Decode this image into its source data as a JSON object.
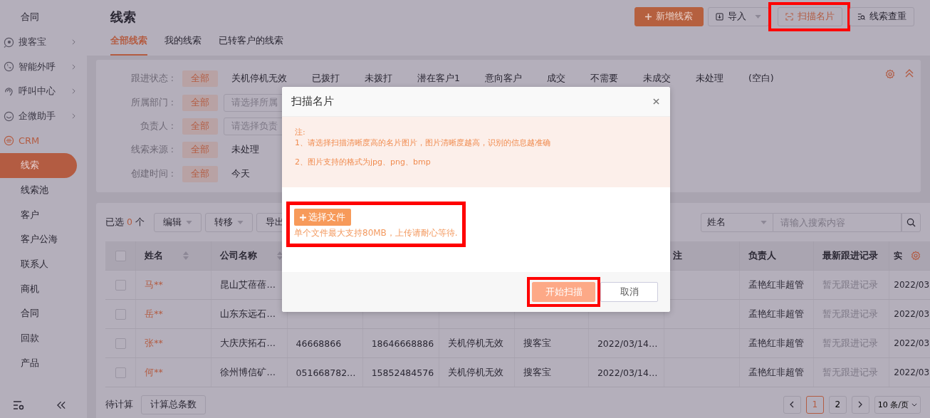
{
  "sidebar": {
    "items": [
      {
        "kind": "sub",
        "label": "合同",
        "selected": false
      },
      {
        "kind": "group",
        "label": "搜客宝",
        "expanded": false
      },
      {
        "kind": "group",
        "label": "智能外呼",
        "expanded": false
      },
      {
        "kind": "group",
        "label": "呼叫中心",
        "expanded": false
      },
      {
        "kind": "group",
        "label": "企微助手",
        "expanded": false
      },
      {
        "kind": "group",
        "label": "CRM",
        "expanded": true,
        "children": [
          {
            "label": "线索",
            "selected": true
          },
          {
            "label": "线索池",
            "selected": false
          },
          {
            "label": "客户",
            "selected": false
          },
          {
            "label": "客户公海",
            "selected": false
          },
          {
            "label": "联系人",
            "selected": false
          },
          {
            "label": "商机",
            "selected": false
          },
          {
            "label": "合同",
            "selected": false
          },
          {
            "label": "回款",
            "selected": false
          },
          {
            "label": "产品",
            "selected": false
          }
        ]
      }
    ]
  },
  "header": {
    "title": "线索",
    "tabs": [
      {
        "label": "全部线索",
        "selected": true
      },
      {
        "label": "我的线索",
        "selected": false
      },
      {
        "label": "已转客户的线索",
        "selected": false
      }
    ],
    "actions": [
      {
        "label": "新增线索",
        "kind": "primary",
        "dropdown": false,
        "highlighted": false
      },
      {
        "label": "导入",
        "kind": "default",
        "dropdown": true,
        "highlighted": false
      },
      {
        "label": "扫描名片",
        "kind": "accent",
        "dropdown": false,
        "highlighted": true
      },
      {
        "label": "线索查重",
        "kind": "default",
        "dropdown": false,
        "highlighted": false
      }
    ]
  },
  "filters": [
    {
      "label": "跟进状态 :",
      "all": {
        "label": "全部",
        "selected": true
      },
      "kind": "options",
      "options": [
        "关机停机无效",
        "已拨打",
        "未拨打",
        "潜在客户1",
        "意向客户",
        "成交",
        "不需要",
        "未成交",
        "未处理",
        "(空白)"
      ]
    },
    {
      "label": "所属部门 :",
      "all": {
        "label": "全部",
        "selected": true
      },
      "kind": "select",
      "placeholder": "请选择所属"
    },
    {
      "label": "负责人 :",
      "all": {
        "label": "全部",
        "selected": true
      },
      "kind": "select",
      "placeholder": "请选择负责"
    },
    {
      "label": "线索来源 :",
      "all": {
        "label": "全部",
        "selected": true
      },
      "kind": "options",
      "options": [
        "未处理"
      ]
    },
    {
      "label": "创建时间 :",
      "all": {
        "label": "全部",
        "selected": true
      },
      "kind": "options",
      "options": [
        "今天"
      ]
    }
  ],
  "toolbar": {
    "selected_prefix": "已选",
    "selected_count": "0",
    "selected_suffix": "个",
    "buttons": [
      {
        "label": "编辑",
        "dropdown": true
      },
      {
        "label": "转移",
        "dropdown": true
      },
      {
        "label": "导出",
        "dropdown": false
      }
    ],
    "search_field": "姓名",
    "search_placeholder": "请输入搜索内容"
  },
  "table": {
    "header_checked": false,
    "columns": [
      {
        "label": "姓名",
        "sortable": true
      },
      {
        "label": "公司名称",
        "sortable": true
      },
      null,
      null,
      null,
      null,
      null,
      {
        "label": "注"
      },
      {
        "label": "负责人"
      },
      {
        "label": "最新跟进记录"
      },
      {
        "label": "实"
      }
    ],
    "rows": [
      {
        "checked": false,
        "cells": [
          "马**",
          "昆山艾蓓蓓…",
          null,
          null,
          null,
          null,
          null,
          null,
          "孟艳红非超管",
          "暂无跟进记录",
          "2022/03"
        ]
      },
      {
        "checked": false,
        "cells": [
          "岳**",
          "山东东远石…",
          null,
          null,
          null,
          null,
          null,
          null,
          "孟艳红非超管",
          "暂无跟进记录",
          "2022/03"
        ]
      },
      {
        "checked": false,
        "cells": [
          "张**",
          "大庆庆拓石…",
          "46668866",
          "18646668886",
          "关机停机无效",
          "搜客宝",
          "2022/03/14…",
          null,
          "孟艳红非超管",
          "暂无跟进记录",
          "2022/03"
        ]
      },
      {
        "checked": false,
        "cells": [
          "何**",
          "徐州博信矿…",
          "051668782…",
          "15852484576",
          "关机停机无效",
          "搜客宝",
          "2022/03/14…",
          null,
          "孟艳红非超管",
          "暂无跟进记录",
          "2022/03"
        ]
      }
    ]
  },
  "footer": {
    "status": "待计算",
    "count_button": "计算总条数",
    "pages": [
      {
        "label": "1",
        "selected": true
      },
      {
        "label": "2",
        "selected": false
      }
    ],
    "page_size": "10 条/页"
  },
  "modal": {
    "title": "扫描名片",
    "notes": [
      "注:",
      "1、请选择扫描清晰度高的名片图片，图片清晰度越高，识别的信息越准确",
      "2、图片支持的格式为jpg、png、bmp"
    ],
    "upload": {
      "label": "选择文件",
      "hint": "单个文件最大支持80MB，上传请耐心等待.",
      "highlighted": true
    },
    "buttons": [
      {
        "label": "开始扫描",
        "kind": "primary",
        "highlighted": true
      },
      {
        "label": "取消",
        "kind": "default",
        "highlighted": false
      }
    ]
  }
}
